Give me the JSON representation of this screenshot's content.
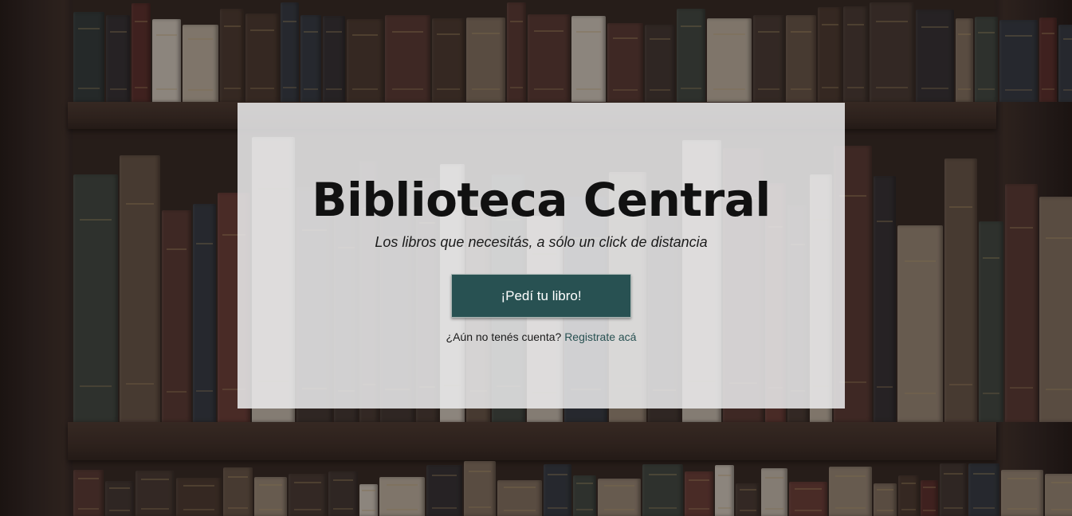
{
  "hero": {
    "title": "Biblioteca Central",
    "subtitle": "Los libros que necesitás, a sólo un click de distancia",
    "cta_label": "¡Pedí tu libro!",
    "signup_prompt": "¿Aún no tenés cuenta?",
    "signup_link": "Registrate acá"
  },
  "colors": {
    "panel_bg": "#ececee",
    "button_bg": "#285152",
    "button_text": "#ffffff",
    "link": "#285152",
    "title": "#111111"
  }
}
